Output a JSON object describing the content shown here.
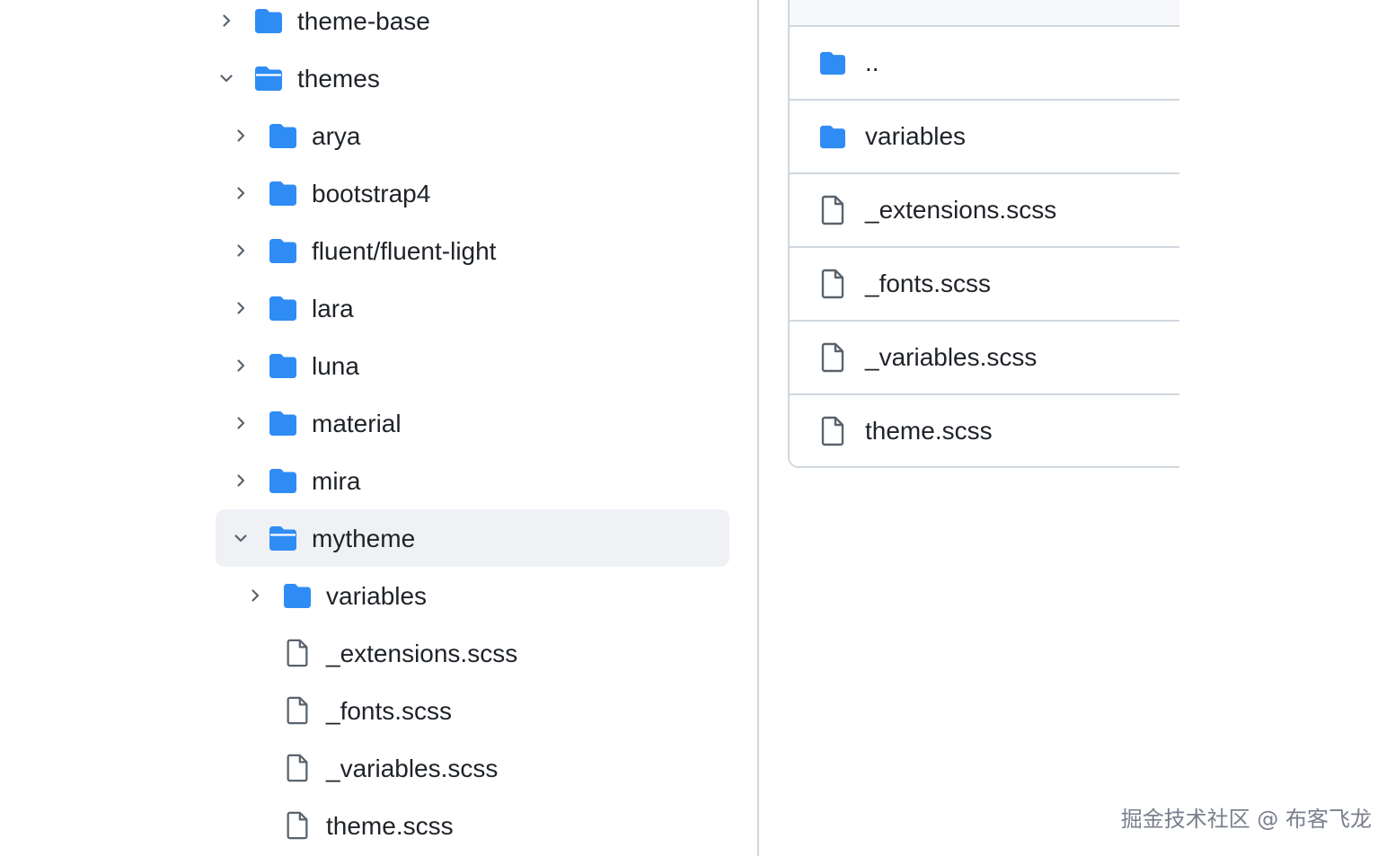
{
  "colors": {
    "folder": "#2f8cf5",
    "file_stroke": "#59636e",
    "chevron": "#59636e",
    "selected_bg": "#eff1f5",
    "border": "#d0d7de"
  },
  "tree": [
    {
      "label": "theme-base",
      "type": "folder",
      "depth": 0,
      "expanded": false
    },
    {
      "label": "themes",
      "type": "folder-open",
      "depth": 0,
      "expanded": true
    },
    {
      "label": "arya",
      "type": "folder",
      "depth": 1,
      "expanded": false
    },
    {
      "label": "bootstrap4",
      "type": "folder",
      "depth": 1,
      "expanded": false
    },
    {
      "label": "fluent/fluent-light",
      "type": "folder",
      "depth": 1,
      "expanded": false
    },
    {
      "label": "lara",
      "type": "folder",
      "depth": 1,
      "expanded": false
    },
    {
      "label": "luna",
      "type": "folder",
      "depth": 1,
      "expanded": false
    },
    {
      "label": "material",
      "type": "folder",
      "depth": 1,
      "expanded": false
    },
    {
      "label": "mira",
      "type": "folder",
      "depth": 1,
      "expanded": false
    },
    {
      "label": "mytheme",
      "type": "folder-open",
      "depth": 1,
      "expanded": true,
      "selected": true
    },
    {
      "label": "variables",
      "type": "folder",
      "depth": 2,
      "expanded": false
    },
    {
      "label": "_extensions.scss",
      "type": "file",
      "depth": 2
    },
    {
      "label": "_fonts.scss",
      "type": "file",
      "depth": 2
    },
    {
      "label": "_variables.scss",
      "type": "file",
      "depth": 2
    },
    {
      "label": "theme.scss",
      "type": "file",
      "depth": 2
    }
  ],
  "list": [
    {
      "label": "..",
      "type": "folder"
    },
    {
      "label": "variables",
      "type": "folder"
    },
    {
      "label": "_extensions.scss",
      "type": "file"
    },
    {
      "label": "_fonts.scss",
      "type": "file"
    },
    {
      "label": "_variables.scss",
      "type": "file"
    },
    {
      "label": "theme.scss",
      "type": "file"
    }
  ],
  "watermark": "掘金技术社区 @ 布客飞龙"
}
